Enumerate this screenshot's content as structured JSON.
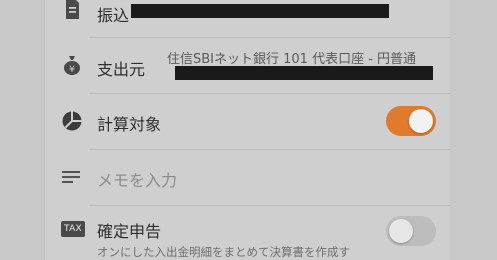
{
  "rows": {
    "transfer": {
      "icon": "document-icon",
      "label": "振込"
    },
    "source": {
      "icon": "money-bag-icon",
      "label": "支出元",
      "value": "住信SBIネット銀行 101 代表口座 - 円普通"
    },
    "calculation_target": {
      "icon": "pie-chart-icon",
      "label": "計算対象",
      "toggle_on": true
    },
    "memo": {
      "icon": "lines-icon",
      "placeholder": "メモを入力"
    },
    "tax_return": {
      "badge": "TAX",
      "label": "確定申告",
      "description": "オンにした入出金明細をまとめて決算書を作成す",
      "toggle_on": false
    }
  },
  "colors": {
    "accent": "#e07a2c",
    "toggle_off_track": "#bdbdbd"
  }
}
